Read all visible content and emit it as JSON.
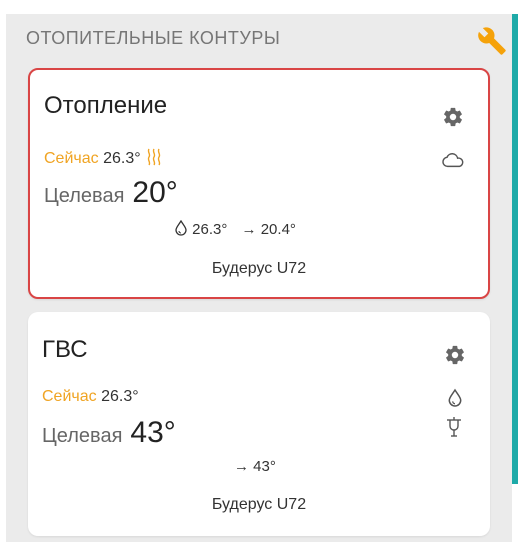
{
  "header": {
    "title": "ОТОПИТЕЛЬНЫЕ КОНТУРЫ"
  },
  "colors": {
    "accent": "#1eaaa8",
    "now": "#f0a423",
    "selected_border": "#d94545",
    "wrench": "#f5a20a"
  },
  "cards": [
    {
      "title": "Отопление",
      "now_label": "Сейчас",
      "now_value": "26.3°",
      "target_label": "Целевая",
      "target_value": "20°",
      "flow_temp": "26.3°",
      "arrow_temp": "20.4°",
      "boiler": "Будерус U72",
      "icons": [
        "gear-icon",
        "heat-waves-icon",
        "cloud-icon",
        "water-drop-icon",
        "arrow-right-icon"
      ]
    },
    {
      "title": "ГВС",
      "now_label": "Сейчас",
      "now_value": "26.3°",
      "target_label": "Целевая",
      "target_value": "43°",
      "arrow_temp": "43°",
      "boiler": "Будерус U72",
      "icons": [
        "gear-icon",
        "water-drop-icon",
        "tap-icon",
        "arrow-right-icon"
      ]
    }
  ]
}
